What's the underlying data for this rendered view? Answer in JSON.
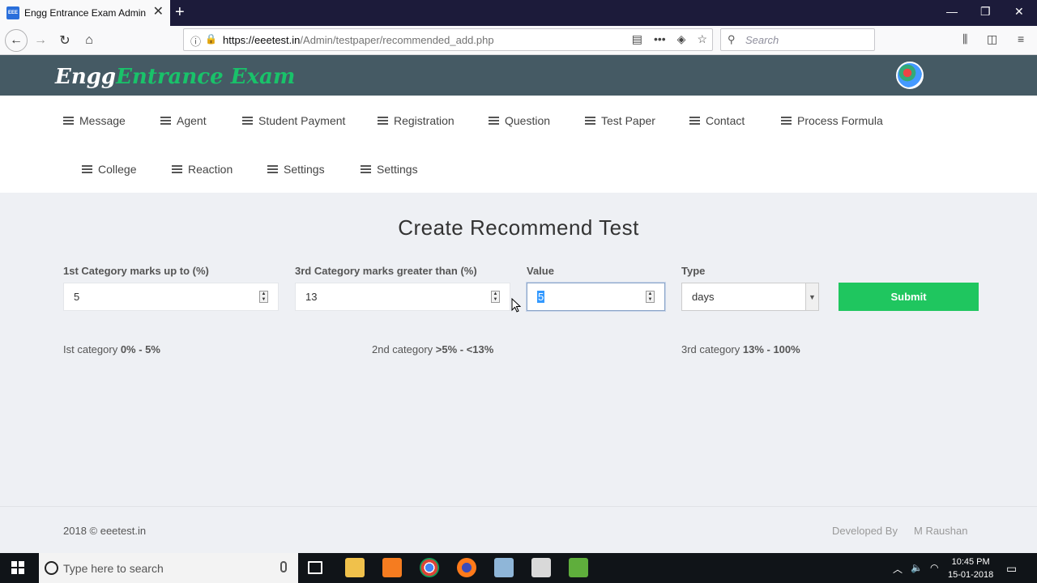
{
  "browser": {
    "tab_title": "Engg Entrance Exam Admin",
    "favicon_text": "EEE",
    "url_host": "https://eeetest.in",
    "url_path": "/Admin/testpaper/recommended_add.php",
    "search_placeholder": "Search"
  },
  "header": {
    "logo_part1": "Engg",
    "logo_part2": "Entrance Exam",
    "logo_color": "#19c26a",
    "bg_color": "#455a64"
  },
  "menu": {
    "items": [
      "Message",
      "Agent",
      "Student Payment",
      "Registration",
      "Question",
      "Test Paper",
      "Contact",
      "Process Formula",
      "College",
      "Reaction",
      "Settings",
      "Settings"
    ]
  },
  "form": {
    "title": "Create Recommend Test",
    "cat1_label": "1st Category marks up to (%)",
    "cat1_value": "5",
    "cat3_label": "3rd Category marks greater than (%)",
    "cat3_value": "13",
    "value_label": "Value",
    "value_value": "5",
    "type_label": "Type",
    "type_value": "days",
    "submit_label": "Submit",
    "submit_color": "#1fc65f"
  },
  "categories": {
    "c1_prefix": "Ist category ",
    "c1_range": "0% - 5%",
    "c2_prefix": "2nd category ",
    "c2_range": ">5% - <13%",
    "c3_prefix": "3rd category ",
    "c3_range": "13% - 100%"
  },
  "footer": {
    "copyright": "2018 © eeetest.in",
    "developed_by": "Developed By",
    "developer": "M Raushan"
  },
  "taskbar": {
    "search_placeholder": "Type here to search",
    "time": "10:45 PM",
    "date": "15-01-2018"
  }
}
